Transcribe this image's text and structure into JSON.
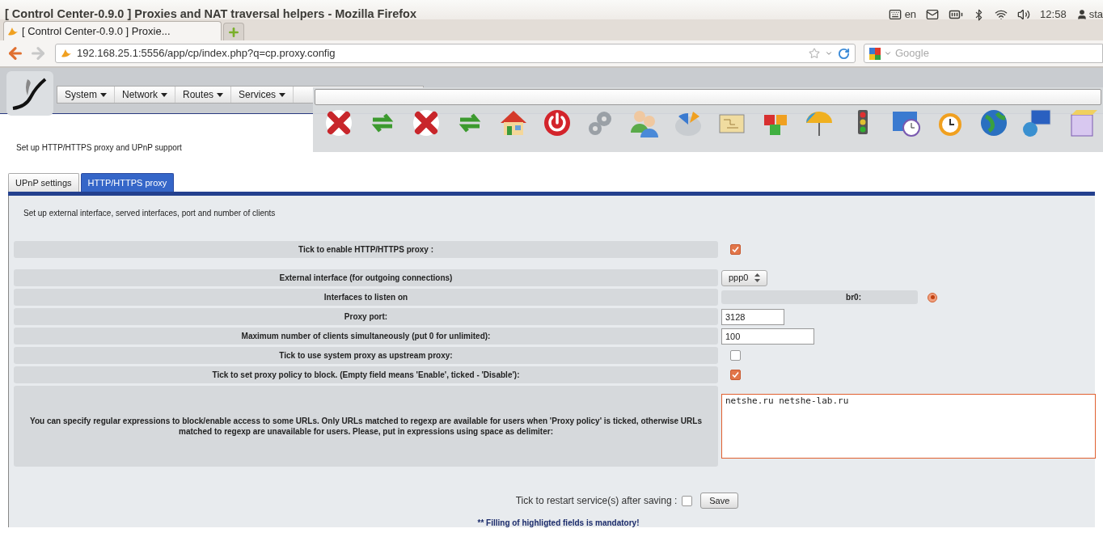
{
  "window": {
    "title": "[ Control Center-0.9.0 ] Proxies and NAT traversal helpers - Mozilla Firefox"
  },
  "status_bar": {
    "language": "en",
    "clock": "12:58",
    "user": "sta"
  },
  "browser": {
    "tabs": [
      {
        "label": "[ Control Center-0.9.0 ] Proxie...",
        "selected": true
      }
    ],
    "url": "192.168.25.1:5556/app/cp/index.php?q=cp.proxy.config",
    "search_placeholder": "Google"
  },
  "menu": [
    "System",
    "Network",
    "Routes",
    "Services"
  ],
  "page_heading": "Set up HTTP/HTTPS proxy and UPnP support",
  "tabs": [
    {
      "label": "UPnP settings",
      "selected": false
    },
    {
      "label": "HTTP/HTTPS proxy",
      "selected": true
    }
  ],
  "panel_description": "Set up external interface, served interfaces, port and number of clients",
  "enable_row": {
    "label": "Tick to enable HTTP/HTTPS proxy :",
    "checked": true
  },
  "settings": [
    {
      "kind": "select",
      "label": "External interface (for outgoing connections)",
      "value": "ppp0"
    },
    {
      "kind": "interface",
      "label": "Interfaces to listen on",
      "value": "br0:",
      "selected": true
    },
    {
      "kind": "text",
      "label": "Proxy port:",
      "value": "3128"
    },
    {
      "kind": "text",
      "label": "Maximum number of clients simultaneously (put 0 for unlimited):",
      "value": "100"
    },
    {
      "kind": "checkbox",
      "label": "Tick to use system proxy as upstream proxy:",
      "checked": false
    },
    {
      "kind": "checkbox",
      "label": "Tick to set proxy policy to block. (Empty field means 'Enable', ticked - 'Disable'):",
      "checked": true
    },
    {
      "kind": "textarea",
      "label": "You can specify regular expressions to block/enable access to some URLs. Only URLs matched to regexp are available for users when 'Proxy policy' is ticked, otherwise URLs matched to regexp are unavailable for users. Please, put in expressions using space as delimiter:",
      "value": "netshe.ru netshe-lab.ru",
      "highlighted": true
    }
  ],
  "footer": {
    "restart_label": "Tick to restart service(s) after saving :",
    "restart_checked": false,
    "save_button": "Save",
    "note": "** Filling of highligted fields is mandatory!"
  }
}
